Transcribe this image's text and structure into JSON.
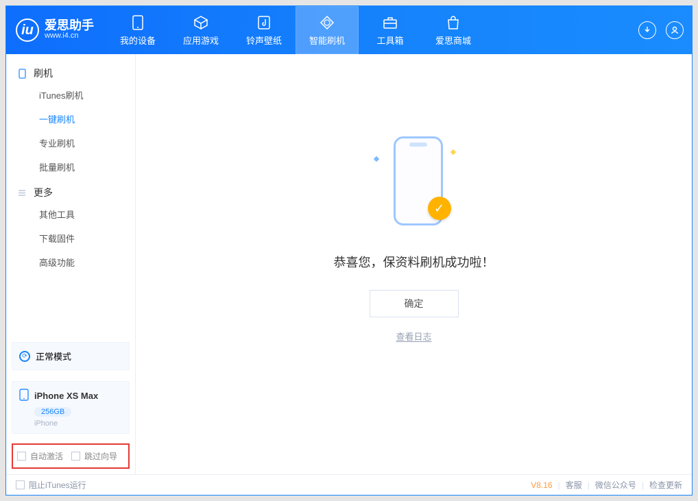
{
  "app": {
    "name_cn": "爱思助手",
    "name_en": "www.i4.cn"
  },
  "tabs": [
    {
      "id": "device",
      "label": "我的设备"
    },
    {
      "id": "apps",
      "label": "应用游戏"
    },
    {
      "id": "ring",
      "label": "铃声壁纸"
    },
    {
      "id": "flash",
      "label": "智能刷机"
    },
    {
      "id": "tools",
      "label": "工具箱"
    },
    {
      "id": "store",
      "label": "爱思商城"
    }
  ],
  "sidebar": {
    "group1_label": "刷机",
    "group1_items": [
      {
        "label": "iTunes刷机"
      },
      {
        "label": "一键刷机"
      },
      {
        "label": "专业刷机"
      },
      {
        "label": "批量刷机"
      }
    ],
    "group2_label": "更多",
    "group2_items": [
      {
        "label": "其他工具"
      },
      {
        "label": "下载固件"
      },
      {
        "label": "高级功能"
      }
    ],
    "mode_label": "正常模式",
    "device": {
      "name": "iPhone XS Max",
      "storage": "256GB",
      "type": "iPhone"
    },
    "check1": "自动激活",
    "check2": "跳过向导"
  },
  "main": {
    "success_text": "恭喜您，保资料刷机成功啦！",
    "ok_button": "确定",
    "log_link": "查看日志"
  },
  "footer": {
    "block_itunes": "阻止iTunes运行",
    "version": "V8.16",
    "links": [
      "客服",
      "微信公众号",
      "检查更新"
    ]
  }
}
